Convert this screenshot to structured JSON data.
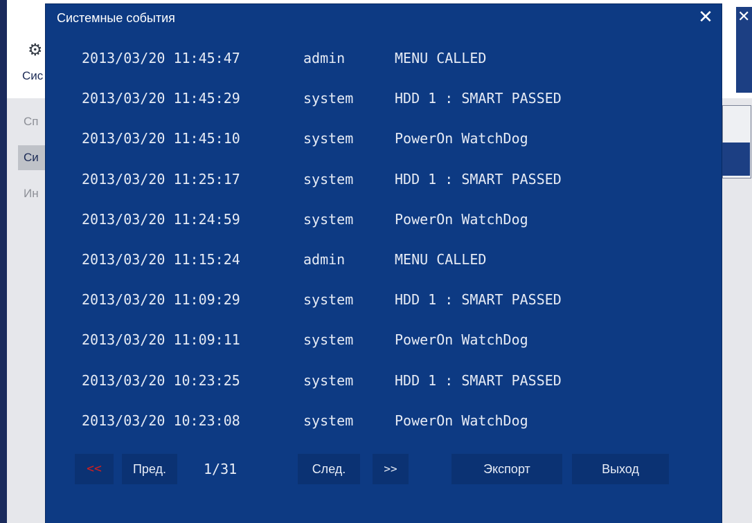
{
  "background": {
    "app_title_fragment": "Сис",
    "menu_items": [
      "Сп",
      "Си",
      "Ин"
    ],
    "active_menu_index": 1,
    "gear_icon": "gear-icon"
  },
  "dialog": {
    "title": "Системные события",
    "close_icon": "close-icon"
  },
  "log_entries": [
    {
      "time": "2013/03/20 11:45:47",
      "user": "admin",
      "event": "MENU CALLED"
    },
    {
      "time": "2013/03/20 11:45:29",
      "user": "system",
      "event": "HDD 1 : SMART PASSED"
    },
    {
      "time": "2013/03/20 11:45:10",
      "user": "system",
      "event": "PowerOn WatchDog"
    },
    {
      "time": "2013/03/20 11:25:17",
      "user": "system",
      "event": "HDD 1 : SMART PASSED"
    },
    {
      "time": "2013/03/20 11:24:59",
      "user": "system",
      "event": "PowerOn WatchDog"
    },
    {
      "time": "2013/03/20 11:15:24",
      "user": "admin",
      "event": "MENU CALLED"
    },
    {
      "time": "2013/03/20 11:09:29",
      "user": "system",
      "event": "HDD 1 : SMART PASSED"
    },
    {
      "time": "2013/03/20 11:09:11",
      "user": "system",
      "event": "PowerOn WatchDog"
    },
    {
      "time": "2013/03/20 10:23:25",
      "user": "system",
      "event": "HDD 1 : SMART PASSED"
    },
    {
      "time": "2013/03/20 10:23:08",
      "user": "system",
      "event": "PowerOn WatchDog"
    }
  ],
  "pagination": {
    "first_label": "<<",
    "prev_label": "Пред.",
    "page": "1/31",
    "next_label": "След.",
    "last_label": ">>"
  },
  "actions": {
    "export_label": "Экспорт",
    "exit_label": "Выход"
  },
  "colors": {
    "dialog_bg": "#0d3a83",
    "text": "#e6ebf5",
    "first_page_accent": "#d1201f"
  }
}
